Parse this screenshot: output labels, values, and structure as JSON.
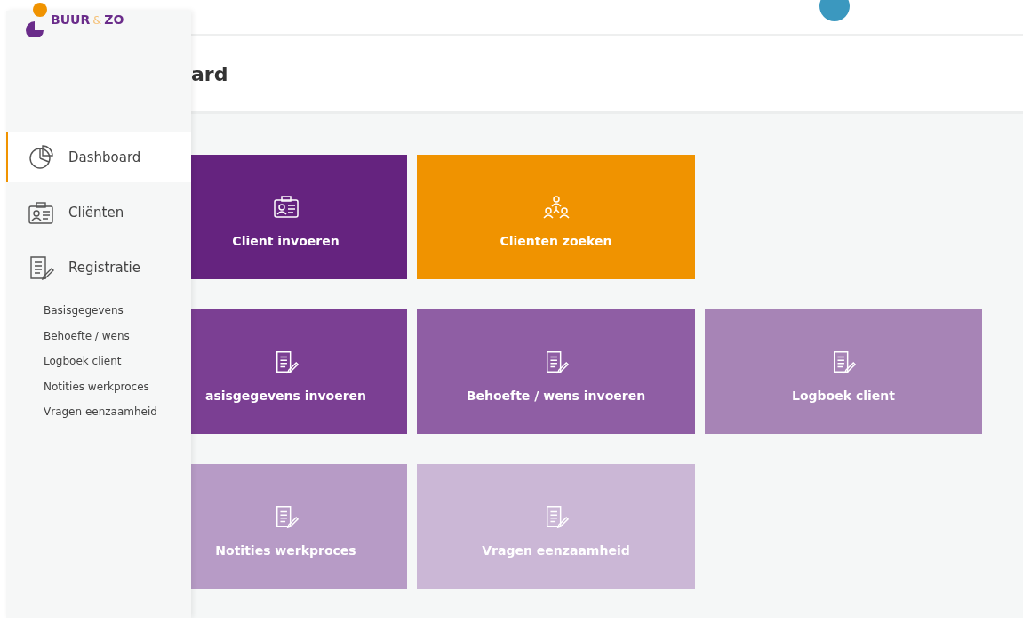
{
  "logo": {
    "first": "BUUR",
    "amp": "&",
    "last": "ZO"
  },
  "nav": [
    {
      "label": "Dashboard",
      "kind": "chart",
      "selected": true
    },
    {
      "label": "Cliënten",
      "kind": "card",
      "selected": false
    },
    {
      "label": "Registratie",
      "kind": "form",
      "selected": false
    }
  ],
  "subnav": [
    "Basisgegevens",
    "Behoefte / wens",
    "Logboek client",
    "Notities werkproces",
    "Vragen eenzaamheid"
  ],
  "page_title": "ard",
  "tile_rows": [
    [
      {
        "label": "Client invoeren",
        "kind": "card",
        "color": "#65237f"
      },
      {
        "label": "Clienten zoeken",
        "kind": "group",
        "color": "#f09300"
      }
    ],
    [
      {
        "label": "asisgegevens invoeren",
        "kind": "form",
        "color": "#7b3f93"
      },
      {
        "label": "Behoefte / wens invoeren",
        "kind": "form",
        "color": "#8f5ea4"
      },
      {
        "label": "Logboek client",
        "kind": "form",
        "color": "#a784b6"
      }
    ],
    [
      {
        "label": "Notities werkproces",
        "kind": "form",
        "color": "#b79bc6"
      },
      {
        "label": "Vragen eenzaamheid",
        "kind": "form",
        "color": "#cbb7d6"
      }
    ]
  ]
}
